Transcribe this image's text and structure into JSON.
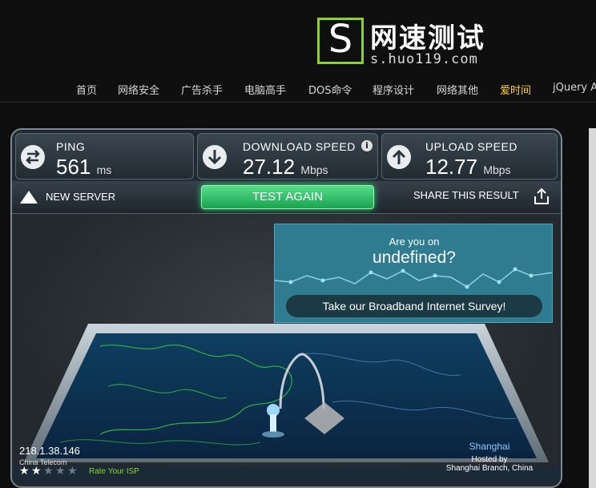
{
  "header": {
    "logo_letter": "S",
    "site_title": "网速测试",
    "site_url": "s.huo119.com",
    "colors": {
      "logo_green": "#8fd12a",
      "nav_active": "#ffd21f"
    },
    "nav": [
      {
        "label": "首页"
      },
      {
        "label": "网络安全"
      },
      {
        "label": "广告杀手"
      },
      {
        "label": "电脑高手"
      },
      {
        "label": "DOS命令"
      },
      {
        "label": "程序设计"
      },
      {
        "label": "网络其他"
      },
      {
        "label": "爱时间",
        "active": true
      },
      {
        "label": "jQuery A"
      }
    ]
  },
  "speedtest": {
    "ping": {
      "label": "PING",
      "value": "561",
      "unit": "ms",
      "icon": "ping-arrows-icon"
    },
    "download": {
      "label": "DOWNLOAD SPEED",
      "value": "27.12",
      "unit": "Mbps",
      "icon": "download-arrow-icon",
      "info": "i"
    },
    "upload": {
      "label": "UPLOAD SPEED",
      "value": "12.77",
      "unit": "Mbps",
      "icon": "upload-arrow-icon"
    },
    "new_server": "NEW SERVER",
    "test_again": "TEST AGAIN",
    "share": "SHARE THIS RESULT",
    "survey": {
      "question": "Are you on",
      "isp": "undefined?",
      "button": "Take our Broadband Internet Survey!"
    },
    "client": {
      "ip": "218.1.38.146",
      "isp": "China Telecom",
      "rating": 2,
      "rating_max": 5,
      "rate_label": "Rate Your ISP"
    },
    "server": {
      "city": "Shanghai",
      "hosted_by": "Hosted by",
      "name": "Shanghai Branch, China"
    },
    "colors": {
      "test_button": "#2fc36a",
      "survey_bg": "#2f7b8f"
    }
  }
}
